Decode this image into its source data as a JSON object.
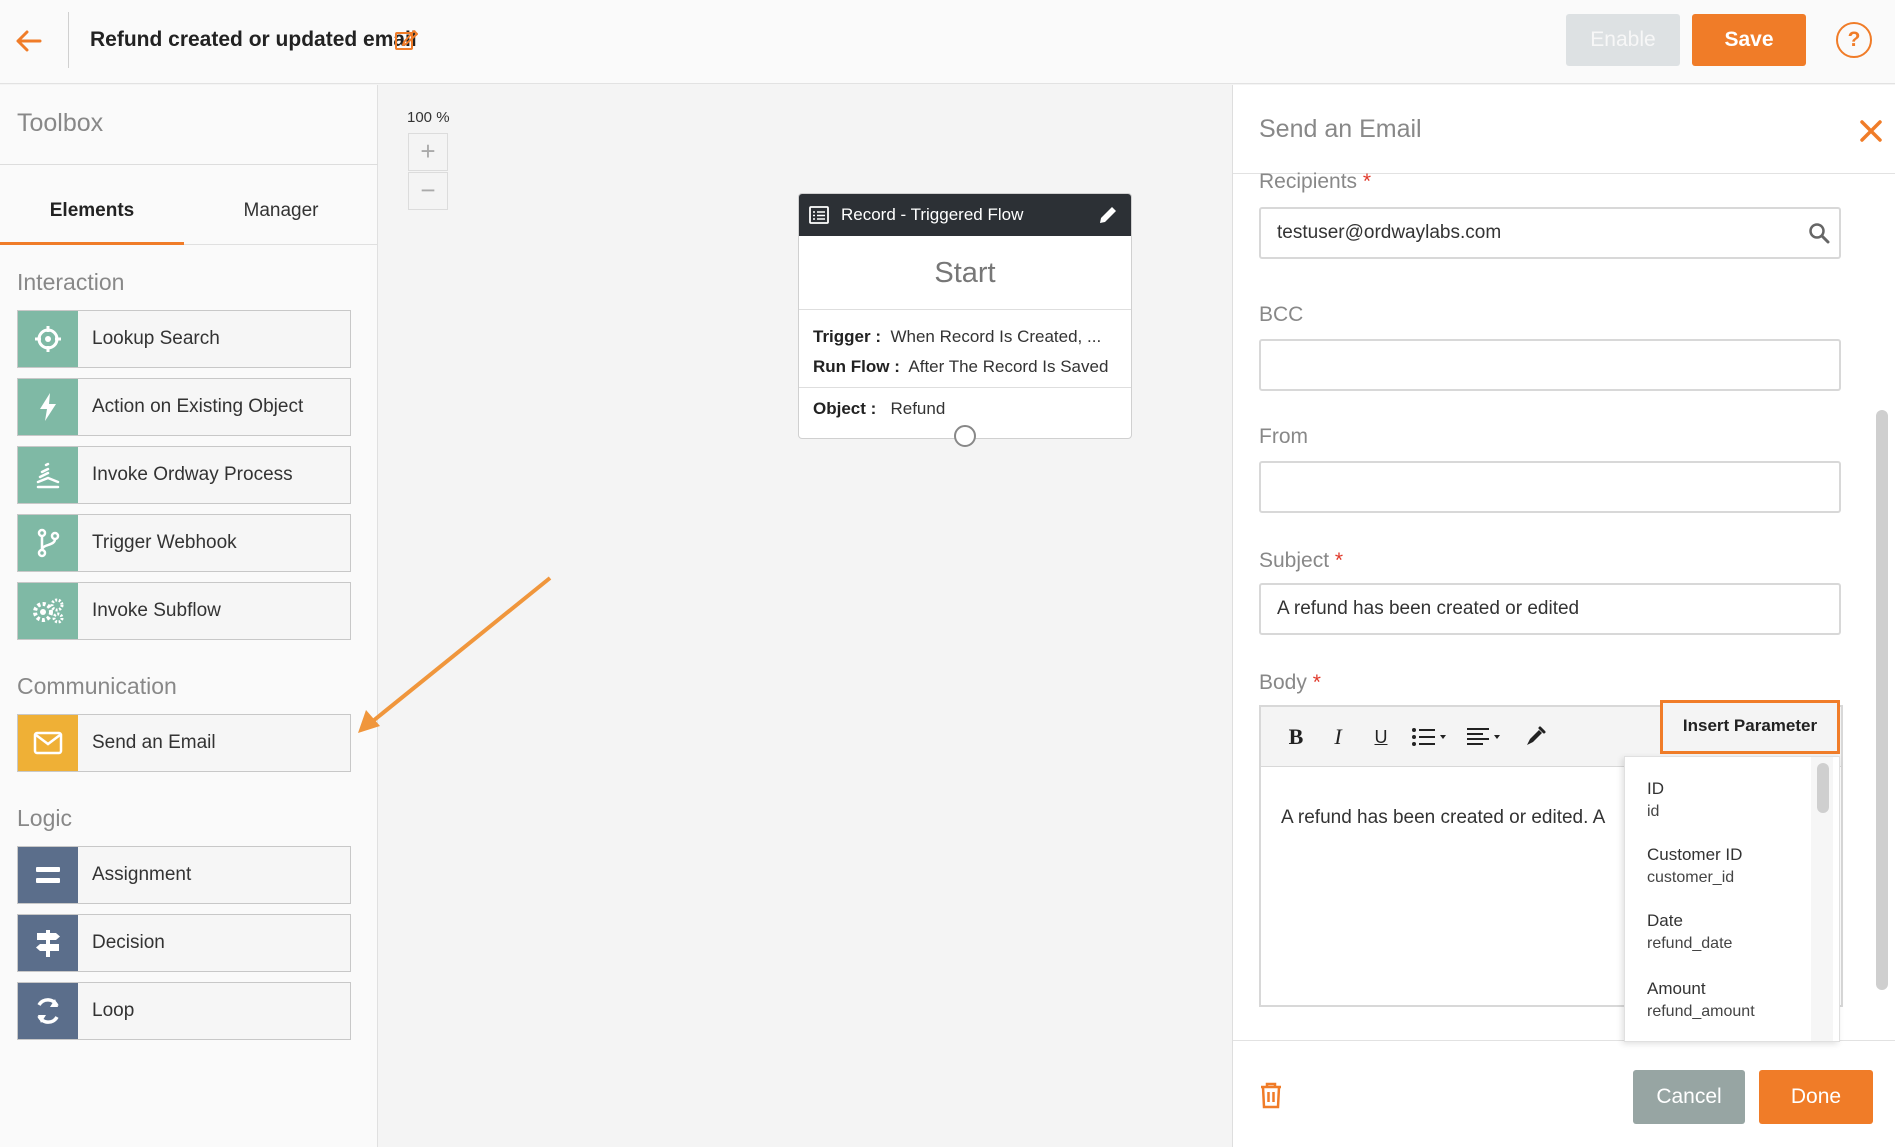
{
  "header": {
    "title": "Refund created or updated email",
    "enable_label": "Enable",
    "save_label": "Save",
    "help_label": "?"
  },
  "toolbox": {
    "title": "Toolbox",
    "tabs": [
      {
        "label": "Elements",
        "active": true
      },
      {
        "label": "Manager",
        "active": false
      }
    ],
    "sections": [
      {
        "label": "Interaction",
        "items": [
          {
            "label": "Lookup Search",
            "icon": "crosshair-icon"
          },
          {
            "label": "Action on Existing Object",
            "icon": "lightning-icon"
          },
          {
            "label": "Invoke Ordway Process",
            "icon": "process-icon"
          },
          {
            "label": "Trigger Webhook",
            "icon": "webhook-icon"
          },
          {
            "label": "Invoke Subflow",
            "icon": "gears-icon"
          }
        ]
      },
      {
        "label": "Communication",
        "items": [
          {
            "label": "Send an Email",
            "icon": "envelope-icon"
          }
        ]
      },
      {
        "label": "Logic",
        "items": [
          {
            "label": "Assignment",
            "icon": "equals-icon"
          },
          {
            "label": "Decision",
            "icon": "signpost-icon"
          },
          {
            "label": "Loop",
            "icon": "loop-icon"
          }
        ]
      }
    ]
  },
  "canvas": {
    "zoom": "100 %",
    "zoom_in": "+",
    "zoom_out": "−",
    "node": {
      "header": "Record - Triggered Flow",
      "start": "Start",
      "trigger_label": "Trigger :",
      "trigger_value": "When Record Is Created, ...",
      "run_flow_label": "Run Flow :",
      "run_flow_value": "After The Record Is Saved",
      "object_label": "Object :",
      "object_value": "Refund"
    }
  },
  "panel": {
    "title": "Send an Email",
    "recipients_label": "Recipients",
    "recipients_value": "testuser@ordwaylabs.com",
    "bcc_label": "BCC",
    "bcc_value": "",
    "from_label": "From",
    "from_value": "",
    "subject_label": "Subject",
    "subject_value": "A refund has been created or edited",
    "body_label": "Body",
    "body_text": "A refund has been created or edited.  A",
    "required_mark": "*",
    "insert_parameter_label": "Insert Parameter",
    "parameters": [
      {
        "name": "ID",
        "key": "id"
      },
      {
        "name": "Customer ID",
        "key": "customer_id"
      },
      {
        "name": "Date",
        "key": "refund_date"
      },
      {
        "name": "Amount",
        "key": "refund_amount"
      }
    ],
    "cancel_label": "Cancel",
    "done_label": "Done"
  },
  "colors": {
    "accent": "#f07c28",
    "interaction_icon_bg": "#7fb9a5",
    "communication_icon_bg": "#efb036",
    "logic_icon_bg": "#5b6e8b"
  }
}
